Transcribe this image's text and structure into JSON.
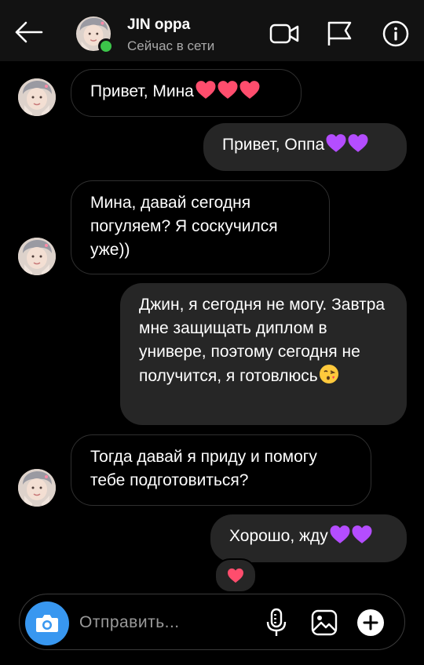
{
  "header": {
    "name": "JIN oppa",
    "status": "Сейчас в сети"
  },
  "messages": [
    {
      "text": "Привет, Мина",
      "emoji": "heart-red-x3"
    },
    {
      "text": "Привет, Оппа",
      "emoji": "heart-purple-x2"
    },
    {
      "text": "Мина, давай сегодня погуляем? Я соскучился уже))"
    },
    {
      "text": "Джин, я сегодня не могу. Завтра мне защищать диплом в универе, поэтому сегодня не получится, я готовлюсь",
      "emoji": "face-blowing-kiss"
    },
    {
      "text": "Тогда давай я приду и помогу тебе подготовиться?"
    },
    {
      "text": "Хорошо, жду",
      "emoji": "heart-purple-x2"
    }
  ],
  "reaction": "heart-red",
  "composer": {
    "placeholder": "Отправить..."
  },
  "colors": {
    "accent": "#3897f0",
    "online": "#3cc54a",
    "my_bubble": "#262626",
    "heart_red": "#ff4d6d",
    "heart_purple": "#b44dff"
  }
}
